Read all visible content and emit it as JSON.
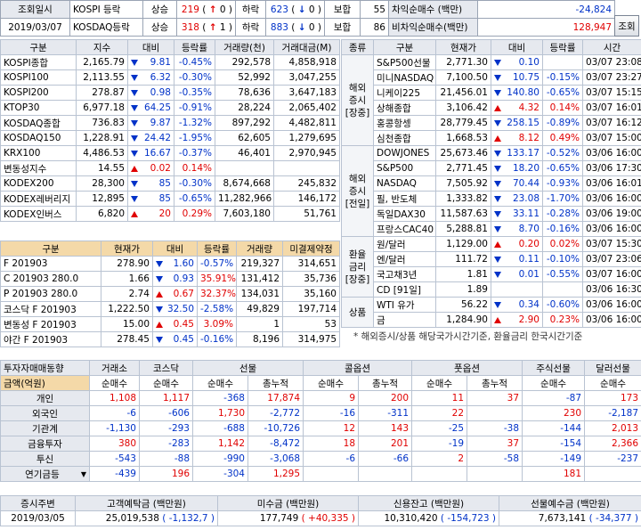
{
  "header": {
    "date_label": "조회일시",
    "date": "2019/03/07",
    "kospi_label": "KOSPI 등락",
    "kosdaq_label": "KOSDAQ등락",
    "rise": "상승",
    "fall": "하락",
    "flat": "보합",
    "kospi_rise": "219",
    "kospi_upper": "0",
    "kospi_fall": "623",
    "kospi_lower": "0",
    "kospi_flat": "55",
    "kosdaq_rise": "318",
    "kosdaq_upper": "1",
    "kosdaq_fall": "883",
    "kosdaq_lower": "0",
    "kosdaq_flat": "86",
    "arb_label": "차익순매수 (백만)",
    "arb_value": "-24,824",
    "nonarb_label": "비차익순매수(백만)",
    "nonarb_value": "128,947",
    "query_button": "조회"
  },
  "index": {
    "headers": [
      "구분",
      "지수",
      "대비",
      "등락률",
      "거래량(천)",
      "거래대금(M)"
    ],
    "rows": [
      {
        "name": "KOSPI종합",
        "value": "2,165.79",
        "dir": "dn",
        "change": "9.81",
        "rate": "-0.45%",
        "vol": "292,578",
        "amt": "4,858,918"
      },
      {
        "name": "KOSPI100",
        "value": "2,113.55",
        "dir": "dn",
        "change": "6.32",
        "rate": "-0.30%",
        "vol": "52,992",
        "amt": "3,047,255"
      },
      {
        "name": "KOSPI200",
        "value": "278.87",
        "dir": "dn",
        "change": "0.98",
        "rate": "-0.35%",
        "vol": "78,636",
        "amt": "3,647,183"
      },
      {
        "name": "KTOP30",
        "value": "6,977.18",
        "dir": "dn",
        "change": "64.25",
        "rate": "-0.91%",
        "vol": "28,224",
        "amt": "2,065,402"
      },
      {
        "name": "KOSDAQ종합",
        "value": "736.83",
        "dir": "dn",
        "change": "9.87",
        "rate": "-1.32%",
        "vol": "897,292",
        "amt": "4,482,811"
      },
      {
        "name": "KOSDAQ150",
        "value": "1,228.91",
        "dir": "dn",
        "change": "24.42",
        "rate": "-1.95%",
        "vol": "62,605",
        "amt": "1,279,695"
      },
      {
        "name": "KRX100",
        "value": "4,486.53",
        "dir": "dn",
        "change": "16.67",
        "rate": "-0.37%",
        "vol": "46,401",
        "amt": "2,970,945"
      },
      {
        "name": "변동성지수",
        "value": "14.55",
        "dir": "up",
        "change": "0.02",
        "rate": "0.14%",
        "vol": "",
        "amt": ""
      },
      {
        "name": "KODEX200",
        "value": "28,300",
        "dir": "dn",
        "change": "85",
        "rate": "-0.30%",
        "vol": "8,674,668",
        "amt": "245,832"
      },
      {
        "name": "KODEX레버리지",
        "value": "12,895",
        "dir": "dn",
        "change": "85",
        "rate": "-0.65%",
        "vol": "11,282,966",
        "amt": "146,172"
      },
      {
        "name": "KODEX인버스",
        "value": "6,820",
        "dir": "up",
        "change": "20",
        "rate": "0.29%",
        "vol": "7,603,180",
        "amt": "51,761"
      }
    ]
  },
  "deriv": {
    "headers": [
      "구분",
      "현재가",
      "대비",
      "등락률",
      "거래량",
      "미결제약정"
    ],
    "rows": [
      {
        "name": "F 201903",
        "value": "278.90",
        "dir": "dn",
        "change": "1.60",
        "rate": "-0.57%",
        "vol": "219,327",
        "oi": "314,651"
      },
      {
        "name": "C 201903 280.0",
        "value": "1.66",
        "dir": "dn",
        "change": "0.93",
        "rate": "35.91%",
        "vol": "131,412",
        "oi": "35,736"
      },
      {
        "name": "P 201903 280.0",
        "value": "2.74",
        "dir": "up",
        "change": "0.67",
        "rate": "32.37%",
        "vol": "134,031",
        "oi": "35,160"
      },
      {
        "name": "코스닥 F 201903",
        "value": "1,222.50",
        "dir": "dn",
        "change": "32.50",
        "rate": "-2.58%",
        "vol": "49,829",
        "oi": "197,714"
      },
      {
        "name": "변동성 F 201903",
        "value": "15.00",
        "dir": "up",
        "change": "0.45",
        "rate": "3.09%",
        "vol": "1",
        "oi": "53"
      },
      {
        "name": "야간 F 201903",
        "value": "278.45",
        "dir": "dn",
        "change": "0.45",
        "rate": "-0.16%",
        "vol": "8,196",
        "oi": "314,975"
      }
    ]
  },
  "world": {
    "headers": [
      "종류",
      "구분",
      "현재가",
      "대비",
      "등락률",
      "시간"
    ],
    "groups": [
      {
        "label": [
          "해외",
          "증시",
          "[장중]"
        ],
        "rows": [
          {
            "name": "S&P500선물",
            "value": "2,771.30",
            "dir": "dn",
            "change": "0.10",
            "rate": "",
            "time": "03/07 23:08"
          },
          {
            "name": "미니NASDAQ",
            "value": "7,100.50",
            "dir": "dn",
            "change": "10.75",
            "rate": "-0.15%",
            "time": "03/07 23:27"
          },
          {
            "name": "니케이225",
            "value": "21,456.01",
            "dir": "dn",
            "change": "140.80",
            "rate": "-0.65%",
            "time": "03/07 15:15"
          },
          {
            "name": "상해종합",
            "value": "3,106.42",
            "dir": "up",
            "change": "4.32",
            "rate": "0.14%",
            "time": "03/07 16:01"
          },
          {
            "name": "홍콩항셍",
            "value": "28,779.45",
            "dir": "dn",
            "change": "258.15",
            "rate": "-0.89%",
            "time": "03/07 16:12"
          },
          {
            "name": "심천종합",
            "value": "1,668.53",
            "dir": "up",
            "change": "8.12",
            "rate": "0.49%",
            "time": "03/07 15:00"
          }
        ]
      },
      {
        "label": [
          "해외",
          "증시",
          "[전일]"
        ],
        "rows": [
          {
            "name": "DOWJONES",
            "value": "25,673.46",
            "dir": "dn",
            "change": "133.17",
            "rate": "-0.52%",
            "time": "03/06 16:00"
          },
          {
            "name": "S&P500",
            "value": "2,771.45",
            "dir": "dn",
            "change": "18.20",
            "rate": "-0.65%",
            "time": "03/06 17:30"
          },
          {
            "name": "NASDAQ",
            "value": "7,505.92",
            "dir": "dn",
            "change": "70.44",
            "rate": "-0.93%",
            "time": "03/06 16:01"
          },
          {
            "name": "필, 반도체",
            "value": "1,333.82",
            "dir": "dn",
            "change": "23.08",
            "rate": "-1.70%",
            "time": "03/06 16:00"
          },
          {
            "name": "독일DAX30",
            "value": "11,587.63",
            "dir": "dn",
            "change": "33.11",
            "rate": "-0.28%",
            "time": "03/06 19:00"
          },
          {
            "name": "프랑스CAC40",
            "value": "5,288.81",
            "dir": "dn",
            "change": "8.70",
            "rate": "-0.16%",
            "time": "03/06 16:00"
          }
        ]
      },
      {
        "label": [
          "환율",
          "금리",
          "[장중]"
        ],
        "rows": [
          {
            "name": "원/달러",
            "value": "1,129.00",
            "dir": "up",
            "change": "0.20",
            "rate": "0.02%",
            "time": "03/07 15:30"
          },
          {
            "name": "엔/달러",
            "value": "111.72",
            "dir": "dn",
            "change": "0.11",
            "rate": "-0.10%",
            "time": "03/07 23:06"
          },
          {
            "name": "국고채3년",
            "value": "1.81",
            "dir": "dn",
            "change": "0.01",
            "rate": "-0.55%",
            "time": "03/07 16:00"
          },
          {
            "name": "CD [91일]",
            "value": "1.89",
            "dir": "",
            "change": "",
            "rate": "",
            "time": "03/06 16:30"
          }
        ]
      },
      {
        "label": [
          "상품"
        ],
        "rows": [
          {
            "name": "WTI 유가",
            "value": "56.22",
            "dir": "dn",
            "change": "0.34",
            "rate": "-0.60%",
            "time": "03/06 16:00"
          },
          {
            "name": "금",
            "value": "1,284.90",
            "dir": "up",
            "change": "2.90",
            "rate": "0.23%",
            "time": "03/06 16:00"
          }
        ]
      }
    ],
    "note": "* 해외증시/상품 해당국가시간기준, 환율금리 한국시간기준"
  },
  "investor": {
    "title": "투자자매매동향",
    "markets": [
      "거래소",
      "코스닥",
      "선물",
      "콜옵션",
      "풋옵션",
      "주식선물",
      "달러선물"
    ],
    "unit_label": "금액(억원)",
    "sub": [
      "순매수",
      "순매수",
      "순매수",
      "총누적",
      "순매수",
      "총누적",
      "순매수",
      "총누적",
      "순매수",
      "순매수"
    ],
    "rows": [
      {
        "name": "개인",
        "v": [
          "1,108",
          "1,117",
          "-368",
          "17,874",
          "9",
          "200",
          "11",
          "37",
          "-87",
          "173"
        ]
      },
      {
        "name": "외국인",
        "v": [
          "-6",
          "-606",
          "1,730",
          "-2,772",
          "-16",
          "-311",
          "22",
          "",
          "230",
          "-2,187"
        ]
      },
      {
        "name": "기관계",
        "v": [
          "-1,130",
          "-293",
          "-688",
          "-10,726",
          "12",
          "143",
          "-25",
          "-38",
          "-144",
          "2,013"
        ]
      },
      {
        "name": "금융투자",
        "v": [
          "380",
          "-283",
          "1,142",
          "-8,472",
          "18",
          "201",
          "-19",
          "37",
          "-154",
          "2,366"
        ]
      },
      {
        "name": "투신",
        "v": [
          "-543",
          "-88",
          "-990",
          "-3,068",
          "-6",
          "-66",
          "2",
          "-58",
          "-149",
          "-237"
        ]
      },
      {
        "name": "연기금등",
        "v": [
          "-439",
          "196",
          "-304",
          "1,295",
          "",
          "",
          "",
          "",
          "181",
          ""
        ]
      }
    ]
  },
  "footer": {
    "headers": [
      "증시주변",
      "고객예탁금 (백만원)",
      "미수금 (백만원)",
      "신용잔고 (백만원)",
      "선물예수금 (백만원)"
    ],
    "date": "2019/03/05",
    "deposit": "25,019,538",
    "deposit_chg": "( -1,132,7 )",
    "unpaid": "177,749",
    "unpaid_chg": "( +40,335 )",
    "credit": "10,310,420",
    "credit_chg": "( -154,723 )",
    "futures": "7,673,141",
    "futures_chg": "( -34,377 )"
  }
}
